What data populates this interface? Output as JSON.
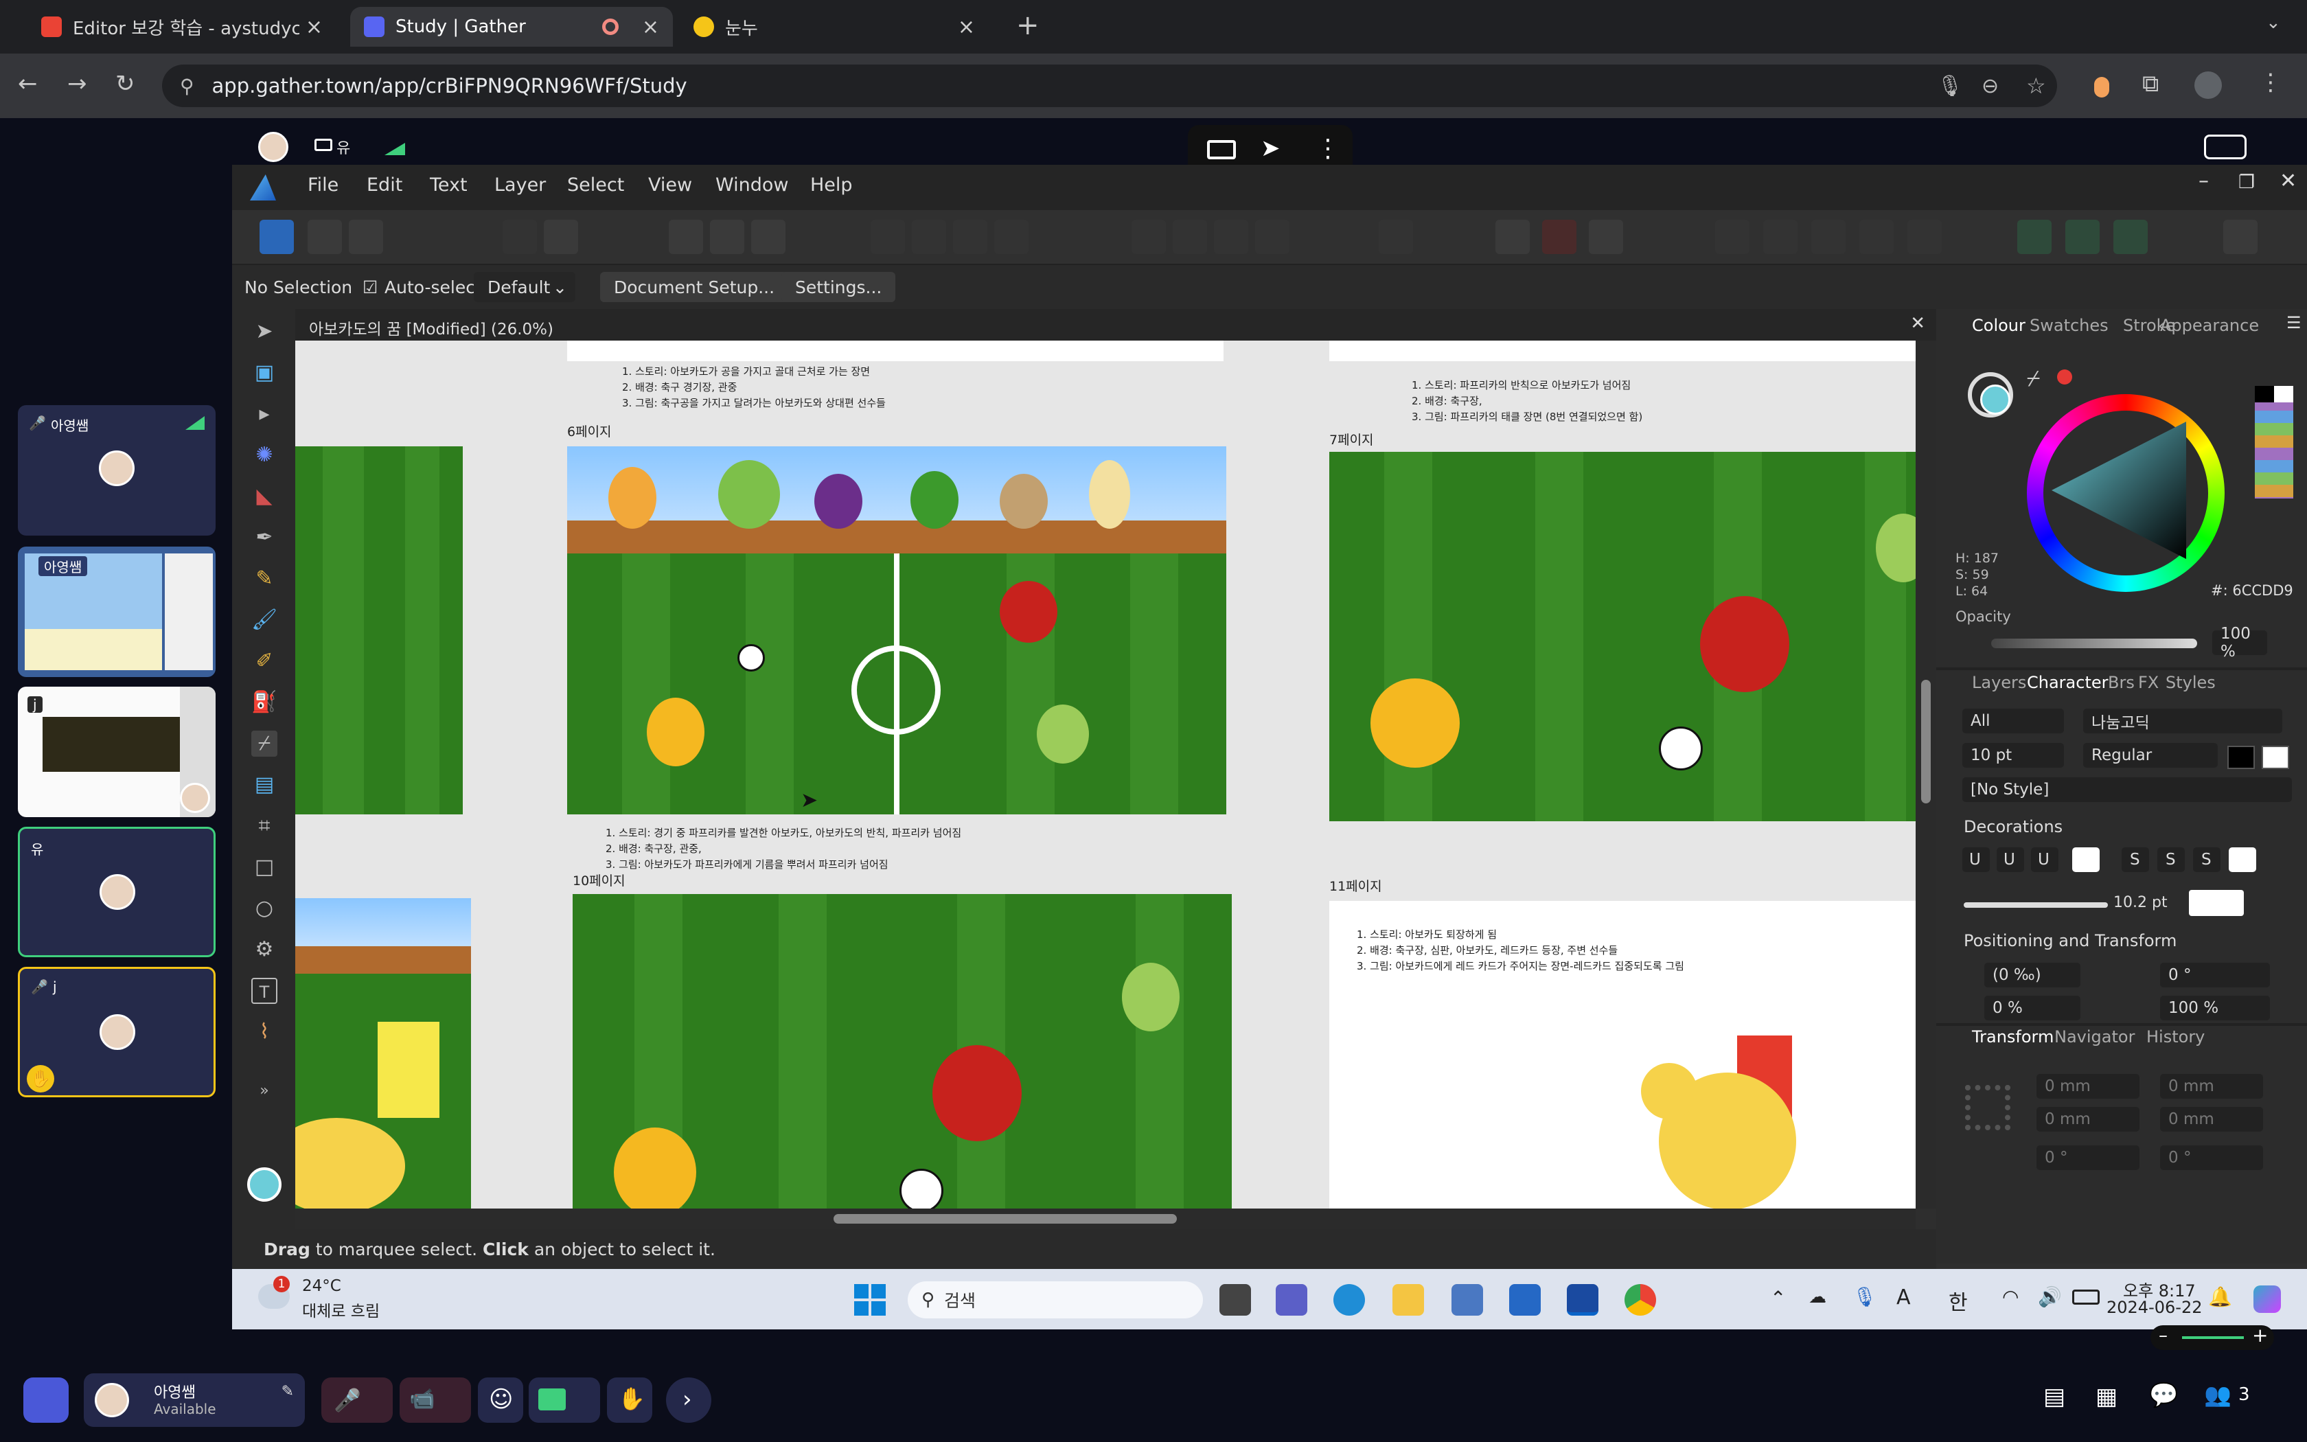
{
  "browser": {
    "tabs": [
      {
        "title": "Editor 보강 학습 - aystudycafe",
        "favicon_color": "#ea4335"
      },
      {
        "title": "Study | Gather",
        "favicon_color": "#5865f2"
      },
      {
        "title": "눈누",
        "favicon_color": "#f5c518"
      }
    ],
    "url": "app.gather.town/app/crBiFPN9QRN96WFf/Study"
  },
  "gather": {
    "self_name_short": "유",
    "participants": [
      {
        "name": "아영쌤"
      },
      {
        "name": "아영쌤"
      },
      {
        "name": "j"
      },
      {
        "name": "유"
      },
      {
        "name": "j"
      }
    ],
    "bottom": {
      "name": "아영쌤",
      "status": "Available",
      "people_count": "3"
    }
  },
  "affinity": {
    "menu": [
      "File",
      "Edit",
      "Text",
      "Layer",
      "Select",
      "View",
      "Window",
      "Help"
    ],
    "context": {
      "selection": "No Selection",
      "autoselect_label": "Auto-select:",
      "autoselect_value": "Default",
      "doc_setup": "Document Setup...",
      "settings": "Settings..."
    },
    "document_tab": "아보카도의 꿈 [Modified] (26.0%)",
    "canvas": {
      "notes": {
        "top_center": "1. 스토리: 아보카도가 공을 가지고 골대 근처로 가는 장면\n2. 배경: 축구 경기장, 관중\n3. 그림: 축구공을 가지고 달려가는 아보카도와 상대편 선수들",
        "top_right": "1. 스토리: 파프리카의 반칙으로 아보카도가 넘어짐\n2. 배경: 축구장,\n3. 그림: 파프리카의 태클 장면 (8번 연결되었으면 함)",
        "mid_center": "1. 스토리: 경기 중 파프리카를 발견한 아보카도, 아보카도의 반칙, 파프리카 넘어짐\n2. 배경: 축구장, 관중,\n3. 그림: 아보카도가 파프리카에게 기름을 뿌려서 파프리카 넘어짐",
        "mid_right": "1. 스토리: 아보카도 퇴장하게 됨\n2. 배경: 축구장, 심판, 아보카도, 레드카드 등장, 주변 선수들\n3. 그림: 아보카드에게 레드 카드가 주어지는 장면-레드카드 집중되도록 그림"
      },
      "page_labels": [
        "6페이지",
        "7페이지",
        "10페이지",
        "11페이지"
      ]
    },
    "right_panel": {
      "tabs_top": [
        "Colour",
        "Swatches",
        "Stroke",
        "Appearance"
      ],
      "hsl": {
        "h": "H: 187",
        "s": "S: 59",
        "l": "L: 64"
      },
      "hex": "#: 6CCDD9",
      "opacity_label": "Opacity",
      "opacity_value": "100 %",
      "tabs_mid": [
        "Layers",
        "Character",
        "Brs",
        "FX",
        "Styles"
      ],
      "char": {
        "filter": "All",
        "font": "나눔고딕",
        "size": "10 pt",
        "weight": "Regular",
        "style": "[No Style]"
      },
      "decorations_label": "Decorations",
      "deco_width": "10.2 pt",
      "positioning_label": "Positioning and Transform",
      "pos": {
        "kern": "(0 ‰)",
        "angle": "0 °",
        "track": "0 %",
        "scale": "100 %"
      },
      "tabs_bottom": [
        "Transform",
        "Navigator",
        "History"
      ],
      "transform": {
        "x": "0 mm",
        "y": "0 mm",
        "w": "0 mm",
        "h": "0 mm",
        "r": "0 °",
        "s": "0 °"
      },
      "colors": {
        "accent": "#6CCDD9"
      }
    },
    "status": {
      "drag": "Drag",
      "drag_rest": " to marquee select. ",
      "click": "Click",
      "click_rest": " an object to select it."
    }
  },
  "taskbar": {
    "weather_temp": "24°C",
    "weather_desc": "대체로 흐림",
    "weather_badge": "1",
    "search": "검색",
    "ime": "한",
    "ime_a": "A",
    "time": "오후 8:17",
    "date": "2024-06-22"
  }
}
